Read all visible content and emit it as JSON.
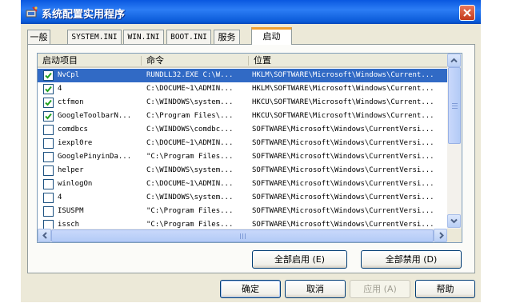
{
  "window": {
    "title": "系统配置实用程序",
    "icon": "msconfig-icon",
    "close_icon": "close-icon"
  },
  "tabs": [
    {
      "label": "一般",
      "active": false
    },
    {
      "label": "SYSTEM.INI",
      "active": false
    },
    {
      "label": "WIN.INI",
      "active": false
    },
    {
      "label": "BOOT.INI",
      "active": false
    },
    {
      "label": "服务",
      "active": false
    },
    {
      "label": "启动",
      "active": true
    }
  ],
  "startup_list": {
    "columns": [
      "启动项目",
      "命令",
      "位置"
    ],
    "rows": [
      {
        "checked": true,
        "name": "NvCpl",
        "command": "RUNDLL32.EXE C:\\W...",
        "location": "HKLM\\SOFTWARE\\Microsoft\\Windows\\Current...",
        "selected": true
      },
      {
        "checked": true,
        "name": "4",
        "command": "C:\\DOCUME~1\\ADMIN...",
        "location": "HKLM\\SOFTWARE\\Microsoft\\Windows\\Current...",
        "selected": false
      },
      {
        "checked": true,
        "name": "ctfmon",
        "command": "C:\\WINDOWS\\system...",
        "location": "HKCU\\SOFTWARE\\Microsoft\\Windows\\Current...",
        "selected": false
      },
      {
        "checked": true,
        "name": "GoogleToolbarN...",
        "command": "C:\\Program Files\\...",
        "location": "HKCU\\SOFTWARE\\Microsoft\\Windows\\Current...",
        "selected": false
      },
      {
        "checked": false,
        "name": "comdbcs",
        "command": "C:\\WINDOWS\\comdbc...",
        "location": "SOFTWARE\\Microsoft\\Windows\\CurrentVersi...",
        "selected": false
      },
      {
        "checked": false,
        "name": "iexpl0re",
        "command": "C:\\DOCUME~1\\ADMIN...",
        "location": "SOFTWARE\\Microsoft\\Windows\\CurrentVersi...",
        "selected": false
      },
      {
        "checked": false,
        "name": "GooglePinyinDa...",
        "command": "\"C:\\Program Files...",
        "location": "SOFTWARE\\Microsoft\\Windows\\CurrentVersi...",
        "selected": false
      },
      {
        "checked": false,
        "name": "helper",
        "command": "C:\\WINDOWS\\system...",
        "location": "SOFTWARE\\Microsoft\\Windows\\CurrentVersi...",
        "selected": false
      },
      {
        "checked": false,
        "name": "winlogOn",
        "command": "C:\\DOCUME~1\\ADMIN...",
        "location": "SOFTWARE\\Microsoft\\Windows\\CurrentVersi...",
        "selected": false
      },
      {
        "checked": false,
        "name": "4",
        "command": "C:\\WINDOWS\\system...",
        "location": "SOFTWARE\\Microsoft\\Windows\\CurrentVersi...",
        "selected": false
      },
      {
        "checked": false,
        "name": "ISUSPM",
        "command": "\"C:\\Program Files...",
        "location": "SOFTWARE\\Microsoft\\Windows\\CurrentVersi...",
        "selected": false
      },
      {
        "checked": false,
        "name": "issch",
        "command": "\"C:\\Program Files...",
        "location": "SOFTWARE\\Microsoft\\Windows\\CurrentVersi...",
        "selected": false
      }
    ]
  },
  "buttons": {
    "enable_all": "全部启用 (E)",
    "disable_all": "全部禁用 (D)",
    "ok": "确定",
    "cancel": "取消",
    "apply": "应用 (A)",
    "help": "帮助"
  },
  "colors": {
    "titlebar": "#0a58e0",
    "selection": "#316ac5",
    "checkbox_check": "#21a121",
    "active_tab_accent": "#f0a030"
  }
}
